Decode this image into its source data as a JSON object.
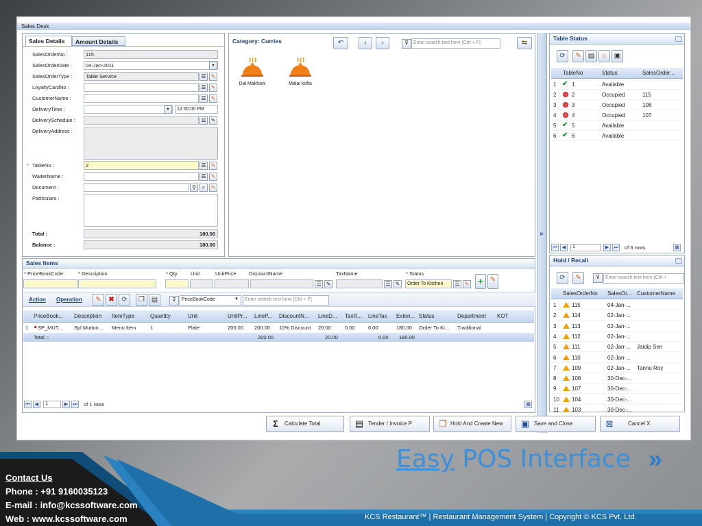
{
  "window": {
    "title": "Sales Desk"
  },
  "left": {
    "tabs": [
      "Sales Details",
      "Amount Details"
    ],
    "labels": {
      "so": "SalesOrderNo :",
      "date": "SalesOrderDate :",
      "type": "SalesOrderType :",
      "loyalty": "LoyaltyCardNo :",
      "cust": "CustomerName :",
      "dtime": "DeliveryTime :",
      "dsched": "DeliverySchedule :",
      "daddr": "DeliveryAddress :",
      "table": "TableNo :",
      "waiter": "WaiterName :",
      "doc": "Document :",
      "part": "Particulars :",
      "total": "Total :",
      "balance": "Balance :"
    },
    "values": {
      "so": "115",
      "date": "04-Jan-2011",
      "type": "Table Service",
      "table": "2",
      "time": "12:00:00 PM",
      "total": "180.00",
      "balance": "180.00"
    },
    "req": "*"
  },
  "category": {
    "title": "Category: Curries",
    "search_placeholder": "Enter search text here [Ctrl + F]",
    "items": [
      "Dal Makhani",
      "Malai kofta"
    ]
  },
  "table_status": {
    "title": "Table Status",
    "columns": [
      "TableNo",
      "Status",
      "SalesOrder..."
    ],
    "rows": [
      {
        "n": "1",
        "no": "1",
        "status": "Available",
        "so": "",
        "icon": "check"
      },
      {
        "n": "2",
        "no": "2",
        "status": "Occupied",
        "so": "115",
        "icon": "red"
      },
      {
        "n": "3",
        "no": "3",
        "status": "Occupied",
        "so": "108",
        "icon": "red"
      },
      {
        "n": "4",
        "no": "4",
        "status": "Occupied",
        "so": "107",
        "icon": "red"
      },
      {
        "n": "5",
        "no": "5",
        "status": "Available",
        "so": "",
        "icon": "check"
      },
      {
        "n": "6",
        "no": "6",
        "status": "Available",
        "so": "",
        "icon": "check"
      }
    ],
    "pager": {
      "page": "1",
      "info": "of 6 rows"
    }
  },
  "hold": {
    "title": "Hold / Recall",
    "search_placeholder": "Enter search text here [Ctrl +",
    "columns": [
      "SalesOrderNo",
      "SalesOr...",
      "CustomerName"
    ],
    "rows": [
      {
        "n": "1",
        "so": "115",
        "date": "04-Jan-...",
        "cust": ""
      },
      {
        "n": "2",
        "so": "114",
        "date": "02-Jan-...",
        "cust": ""
      },
      {
        "n": "3",
        "so": "113",
        "date": "02-Jan-...",
        "cust": ""
      },
      {
        "n": "4",
        "so": "112",
        "date": "02-Jan-...",
        "cust": ""
      },
      {
        "n": "5",
        "so": "111",
        "date": "02-Jan-...",
        "cust": "Jaidip Sen"
      },
      {
        "n": "6",
        "so": "110",
        "date": "02-Jan-...",
        "cust": ""
      },
      {
        "n": "7",
        "so": "109",
        "date": "02-Jan-...",
        "cust": "Tannu Roy"
      },
      {
        "n": "8",
        "so": "108",
        "date": "30-Dec-...",
        "cust": ""
      },
      {
        "n": "9",
        "so": "107",
        "date": "30-Dec-...",
        "cust": ""
      },
      {
        "n": "10",
        "so": "104",
        "date": "30-Dec-...",
        "cust": ""
      },
      {
        "n": "11",
        "so": "103",
        "date": "30-Dec-...",
        "cust": ""
      }
    ]
  },
  "items": {
    "title": "Sales Items",
    "entry_labels": [
      "PriceBookCode",
      "Description",
      "Qty",
      "Unit",
      "UnitPrice",
      "DiscountName",
      "TaxName",
      "Status"
    ],
    "entry_status": "Order To Kitchen",
    "action": "Action",
    "operation": "Operation",
    "filter_field": "PriceBookCode",
    "search_placeholder": "Enter search text here [Ctrl + F]",
    "columns": [
      "PriceBook...",
      "Description",
      "ItemType",
      "Quantity",
      "Unit",
      "UnitPr...",
      "LineP...",
      "DiscountN...",
      "LineD...",
      "TaxR...",
      "LineTax",
      "Exten...",
      "Status",
      "Department",
      "KOT"
    ],
    "row": [
      "SP_MUT...",
      "Spl Mutton ...",
      "Menu Item",
      "1",
      "Plate",
      "200.00",
      "200.00",
      "10% Discount",
      "20.00",
      "0.00",
      "0.00",
      "180.00",
      "Order To Ki...",
      "Traditional",
      ""
    ],
    "row_num": "1",
    "total_label": "Total ::",
    "totals": {
      "linep": "200.00",
      "lined": "20.00",
      "linetax": "0.00",
      "exten": "180.00"
    },
    "pager": {
      "page": "1",
      "info": "of 1 rows"
    }
  },
  "buttons": {
    "calc": "Calculate Total",
    "tender": "Tender / Invoice P",
    "hold": "Hold And Create New",
    "save": "Save and Close",
    "cancel": "Cancel X"
  },
  "slide": {
    "heading_a": "Easy",
    "heading_b": " POS Interface",
    "contact_title": "Contact Us",
    "phone": "Phone : +91 9160035123",
    "email": "E-mail : info@kcssoftware.com",
    "web": "Web : www.kcssoftware.com",
    "footer": "KCS Restaurant™ | Restaurant Management System | Copyright © KCS Pvt. Ltd."
  },
  "colors": {
    "accent": "#1e4f9c",
    "heading": "#3d8fd8",
    "footer_band": "#1f7cb8"
  }
}
